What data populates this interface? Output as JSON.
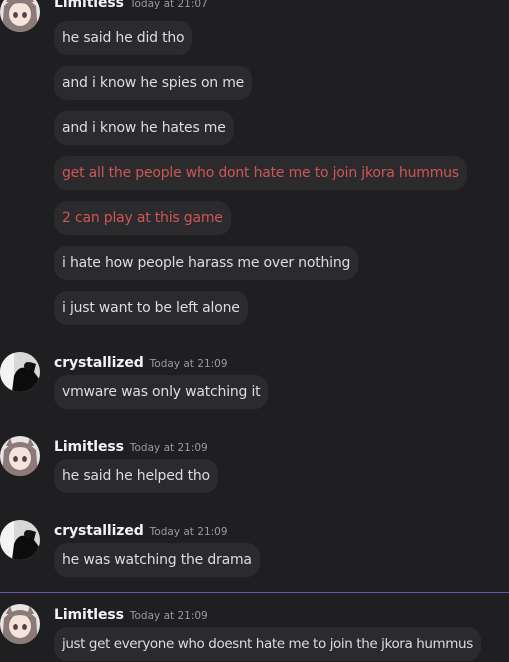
{
  "groups": [
    {
      "username": "Limitless",
      "timestamp": "Today at 21:07",
      "avatar": "anime-girl-avatar",
      "messages": [
        {
          "text": "he said he did tho",
          "color": "#dbdee1"
        },
        {
          "text": "and i know he spies on me",
          "color": "#dbdee1"
        },
        {
          "text": "and i know he hates me",
          "color": "#dbdee1"
        },
        {
          "text": "get all the people who dont hate me to join jkora hummus",
          "color": "#d05555"
        },
        {
          "text": "2 can play at this game",
          "color": "#d05555"
        },
        {
          "text": "i hate how people harass me over nothing",
          "color": "#dbdee1"
        },
        {
          "text": "i just want to be left alone",
          "color": "#dbdee1"
        }
      ]
    },
    {
      "username": "crystallized",
      "timestamp": "Today at 21:09",
      "avatar": "dark-silhouette-avatar",
      "messages": [
        {
          "text": "vmware was only watching it",
          "color": "#dbdee1"
        }
      ]
    },
    {
      "username": "Limitless",
      "timestamp": "Today at 21:09",
      "avatar": "anime-girl-avatar",
      "messages": [
        {
          "text": "he said he helped tho",
          "color": "#dbdee1"
        }
      ]
    },
    {
      "username": "crystallized",
      "timestamp": "Today at 21:09",
      "avatar": "dark-silhouette-avatar",
      "messages": [
        {
          "text": "he was watching the drama",
          "color": "#dbdee1"
        }
      ]
    },
    {
      "username": "Limitless",
      "timestamp": "Today at 21:09",
      "avatar": "anime-girl-avatar",
      "messages": [
        {
          "text": "just get everyone who doesnt hate me to join the jkora hummus",
          "color": "#dbdee1"
        }
      ]
    }
  ],
  "colors": {
    "background": "#1f1f22",
    "bubble": "#2b2b2e",
    "text": "#dbdee1",
    "highlight_text": "#d05555",
    "username": "#f2f3f5",
    "timestamp": "#949ba4",
    "new_divider": "#6e53a8"
  }
}
